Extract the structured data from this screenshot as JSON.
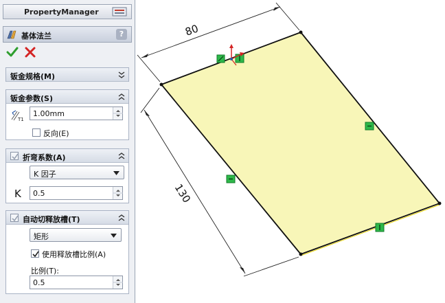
{
  "panel": {
    "header_title": "PropertyManager",
    "feature_name": "基体法兰",
    "help_icon": "?",
    "ok_icon": "check-icon",
    "cancel_icon": "close-icon"
  },
  "sections": {
    "gauge_table": {
      "title": "钣金规格(M)",
      "state": "collapsed"
    },
    "sheet_params": {
      "title": "钣金参数(S)",
      "thickness_value": "1.00mm",
      "reverse_label": "反向(E)",
      "reverse_checked": false
    },
    "bend_allowance": {
      "title": "折弯系数(A)",
      "type_value": "K 因子",
      "k_label": "K",
      "k_value": "0.5"
    },
    "auto_relief": {
      "title": "自动切释放槽(T)",
      "type_value": "矩形",
      "use_ratio_label": "使用释放槽比例(A)",
      "use_ratio_checked": true,
      "ratio_label": "比例(T):",
      "ratio_value": "0.5"
    }
  },
  "viewport": {
    "dim_width": "80",
    "dim_length": "130",
    "sheet_fill": "#f8f6b8"
  }
}
